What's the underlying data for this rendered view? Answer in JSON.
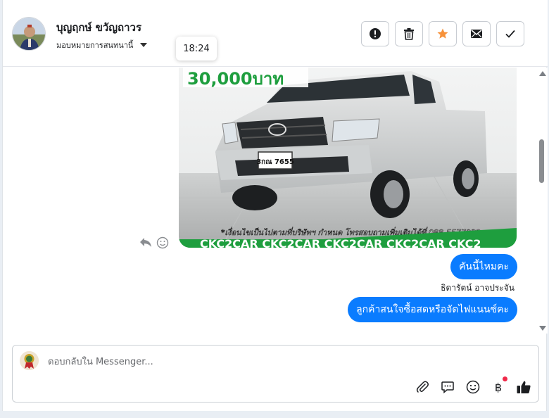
{
  "header": {
    "contact_name": "บุญฤกษ์ ขวัญถาวร",
    "assign_label": "มอบหมายการสนทนานี้",
    "timestamp_tooltip": "18:24",
    "actions": [
      {
        "name": "mark-spam",
        "icon": "alert-circle-icon"
      },
      {
        "name": "delete",
        "icon": "trash-icon"
      },
      {
        "name": "star",
        "icon": "star-icon",
        "color": "#f7923a"
      },
      {
        "name": "mark-unread",
        "icon": "envelope-icon"
      },
      {
        "name": "mark-done",
        "icon": "check-icon"
      }
    ]
  },
  "photo": {
    "price_text": "30,000บาท",
    "plate_text": "3กณ 7655",
    "caption": "*เงื่อนไขเป็นไปตามที่บริษัทฯ กำหนด โทรสอบถามเพิ่มเติมได้ที่ 088-5577932",
    "banner": "CKC2CAR CKC2CAR CKC2CAR CKC2CAR CKC2"
  },
  "messages": {
    "bubble_1": "คันนี้ไหมคะ",
    "sender": "ธิดารัตน์ อาจประจัน",
    "bubble_2": "ลูกค้าสนใจซื้อสดหรือจัดไฟแนนซ์คะ"
  },
  "composer": {
    "placeholder": "ตอบกลับใน Messenger...",
    "value": "",
    "baht_symbol": "฿"
  },
  "colors": {
    "bubble": "#0a7cff",
    "star": "#f7923a",
    "banner_green": "#1e9e3e",
    "notification_dot": "#f02849"
  }
}
